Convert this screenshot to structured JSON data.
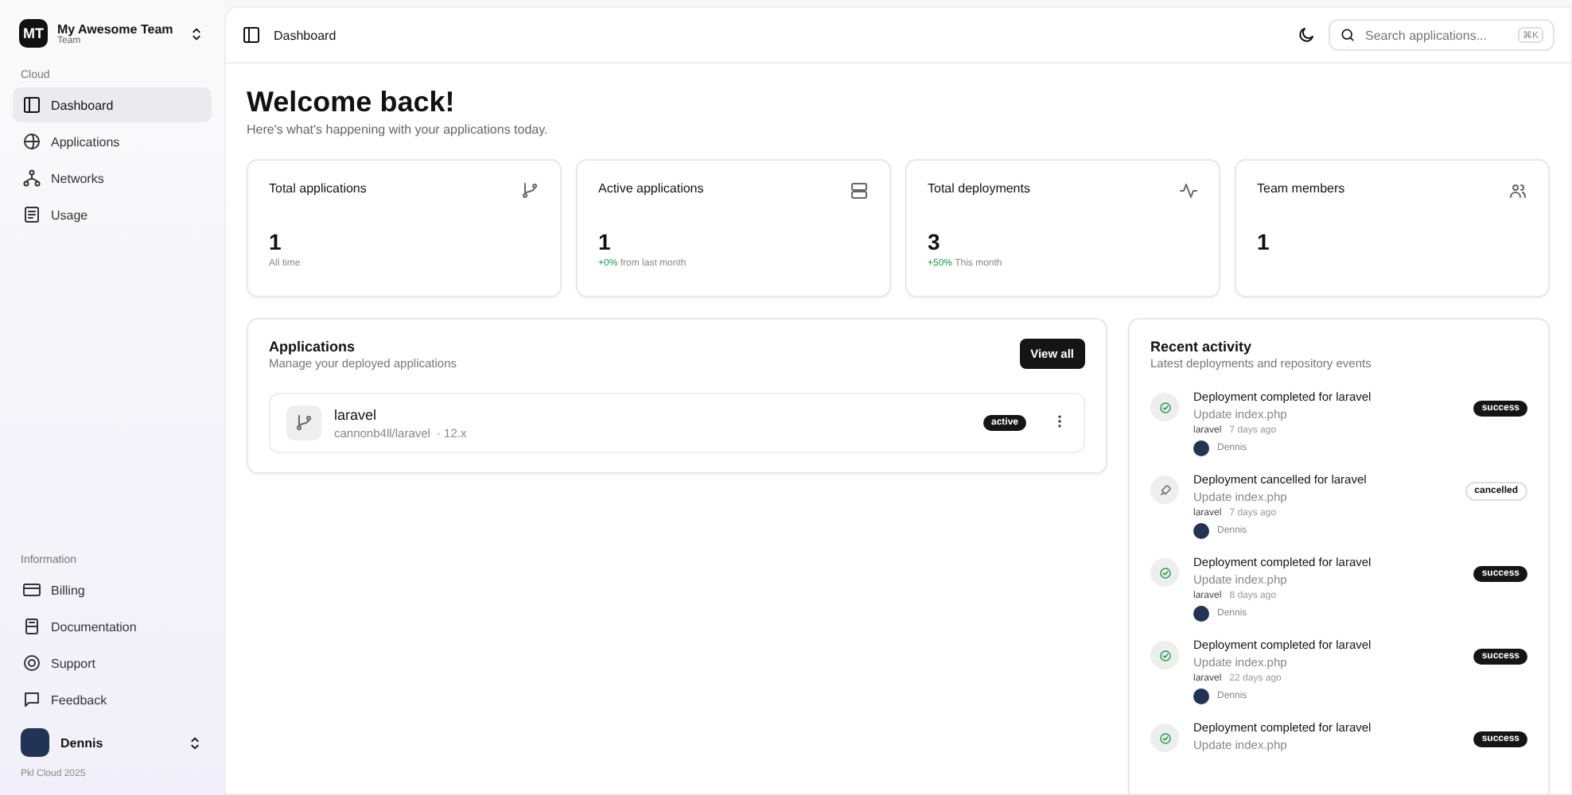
{
  "team": {
    "initials": "MT",
    "name": "My Awesome Team",
    "plan": "Team"
  },
  "nav_sections": [
    {
      "title": "Cloud",
      "items": [
        {
          "label": "Dashboard",
          "selected": true
        },
        {
          "label": "Applications",
          "selected": false
        },
        {
          "label": "Networks",
          "selected": false
        },
        {
          "label": "Usage",
          "selected": false
        }
      ]
    },
    {
      "title": "Information",
      "items": [
        {
          "label": "Billing",
          "selected": false
        },
        {
          "label": "Documentation",
          "selected": false
        },
        {
          "label": "Support",
          "selected": false
        },
        {
          "label": "Feedback",
          "selected": false
        }
      ]
    }
  ],
  "user": {
    "name": "Dennis"
  },
  "footer": "Pkl Cloud 2025",
  "topbar": {
    "breadcrumb": "Dashboard",
    "search": {
      "placeholder": "Search applications...",
      "shortcut": "⌘K"
    }
  },
  "heading": {
    "title": "Welcome back!",
    "subtitle": "Here's what's happening with your applications today."
  },
  "stats": [
    {
      "label": "Total applications",
      "value": "1",
      "note": "All time"
    },
    {
      "label": "Active applications",
      "value": "1",
      "delta": "+0%",
      "note": "from last month"
    },
    {
      "label": "Total deployments",
      "value": "3",
      "delta": "+50%",
      "note": "This month"
    },
    {
      "label": "Team members",
      "value": "1"
    }
  ],
  "applications": {
    "title": "Applications",
    "subtitle": "Manage your deployed applications",
    "button": "View all",
    "items": [
      {
        "name": "laravel",
        "repo": "cannonb4ll/laravel",
        "version": "· 12.x",
        "status": "active"
      }
    ]
  },
  "activity": {
    "title": "Recent activity",
    "subtitle": "Latest deployments and repository events",
    "items": [
      {
        "kind": "success",
        "title": "Deployment completed for laravel",
        "detail": "Update index.php",
        "app": "laravel",
        "time": "7 days ago",
        "user": "Dennis",
        "status": "success"
      },
      {
        "kind": "cancelled",
        "title": "Deployment cancelled for laravel",
        "detail": "Update index.php",
        "app": "laravel",
        "time": "7 days ago",
        "user": "Dennis",
        "status": "cancelled"
      },
      {
        "kind": "success",
        "title": "Deployment completed for laravel",
        "detail": "Update index.php",
        "app": "laravel",
        "time": "8 days ago",
        "user": "Dennis",
        "status": "success"
      },
      {
        "kind": "success",
        "title": "Deployment completed for laravel",
        "detail": "Update index.php",
        "app": "laravel",
        "time": "22 days ago",
        "user": "Dennis",
        "status": "success"
      },
      {
        "kind": "success",
        "title": "Deployment completed for laravel",
        "detail": "Update index.php",
        "status": "success"
      }
    ]
  }
}
